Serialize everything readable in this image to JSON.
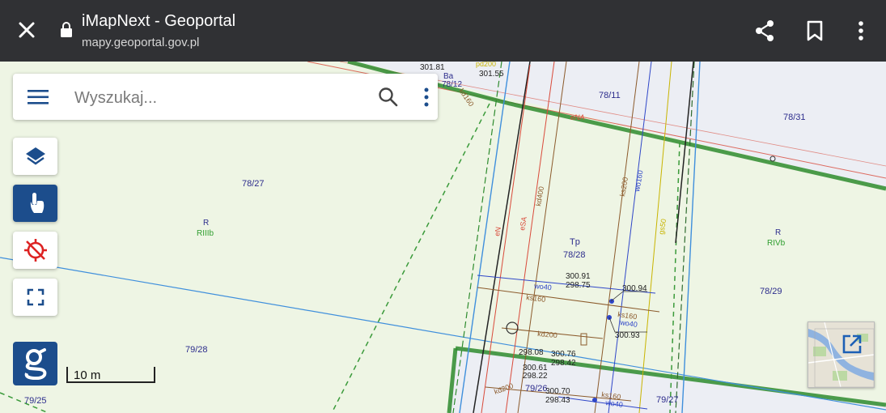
{
  "browser": {
    "title": "iMapNext - Geoportal",
    "url": "mapy.geoportal.gov.pl",
    "icons": [
      "close-icon",
      "lock-icon",
      "share-icon",
      "bookmark-icon",
      "more-vertical-icon"
    ]
  },
  "search": {
    "placeholder": "Wyszukaj...",
    "icons": [
      "menu-icon",
      "search-icon",
      "more-vertical-icon"
    ]
  },
  "tools": {
    "icons": [
      "layers-icon",
      "touch-info-icon",
      "gps-off-icon",
      "fullscreen-icon",
      "geoportal-logo"
    ],
    "active_color": "#1c4d8c"
  },
  "scale_bar": {
    "label": "10 m"
  },
  "map": {
    "parcels": {
      "p78_12": "78/12",
      "p78_11": "78/11",
      "p78_31": "78/31",
      "p78_27": "78/27",
      "p78_28": "78/28",
      "p78_29": "78/29",
      "p79_28": "79/28",
      "p79_25": "79/25",
      "p79_26": "79/26",
      "p79_27": "79/27"
    },
    "land_use": {
      "r_left": "R",
      "riiib": "RIIIb",
      "tp": "Tp",
      "r_right": "R",
      "rivb": "RIVb",
      "ba": "Ba"
    },
    "utility_labels": {
      "ena": "eNA",
      "en": "eN",
      "esa": "eSA",
      "kd400": "kd400",
      "ks200": "ks200",
      "wo160": "wo160",
      "gs50": "gs50",
      "wo40_a": "wo40",
      "ks160_a": "ks160",
      "ks160_b": "ks160",
      "wo40_b": "wo40",
      "kd200_a": "kd200",
      "kd200_b": "kd200",
      "ks160_c": "ks160",
      "wo40_c": "wo40",
      "kd160": "kd160",
      "pd200": "pd200"
    },
    "elevations": {
      "e301_81": "301.81",
      "e301_55": "301.55",
      "e300_91": "300.91",
      "e298_75": "298.75",
      "e300_94": "300.94",
      "e300_93": "300.93",
      "e298_08": "298.08",
      "e300_76": "300.76",
      "e298_42": "298.42",
      "e300_61": "300.61",
      "e298_22": "298.22",
      "e300_70": "300.70",
      "e298_43": "298.43"
    },
    "colors": {
      "parcel_boundary": "#2e8b2e",
      "dashed_green": "#3a9a3a",
      "blue_line": "#3f8fdc",
      "road_fill": "#eceef4",
      "field_fill": "#eef5e4",
      "electric": "#d94a3a",
      "sewer": "#8b5a2b",
      "water": "#2f46c8",
      "gas": "#c8b400"
    }
  }
}
